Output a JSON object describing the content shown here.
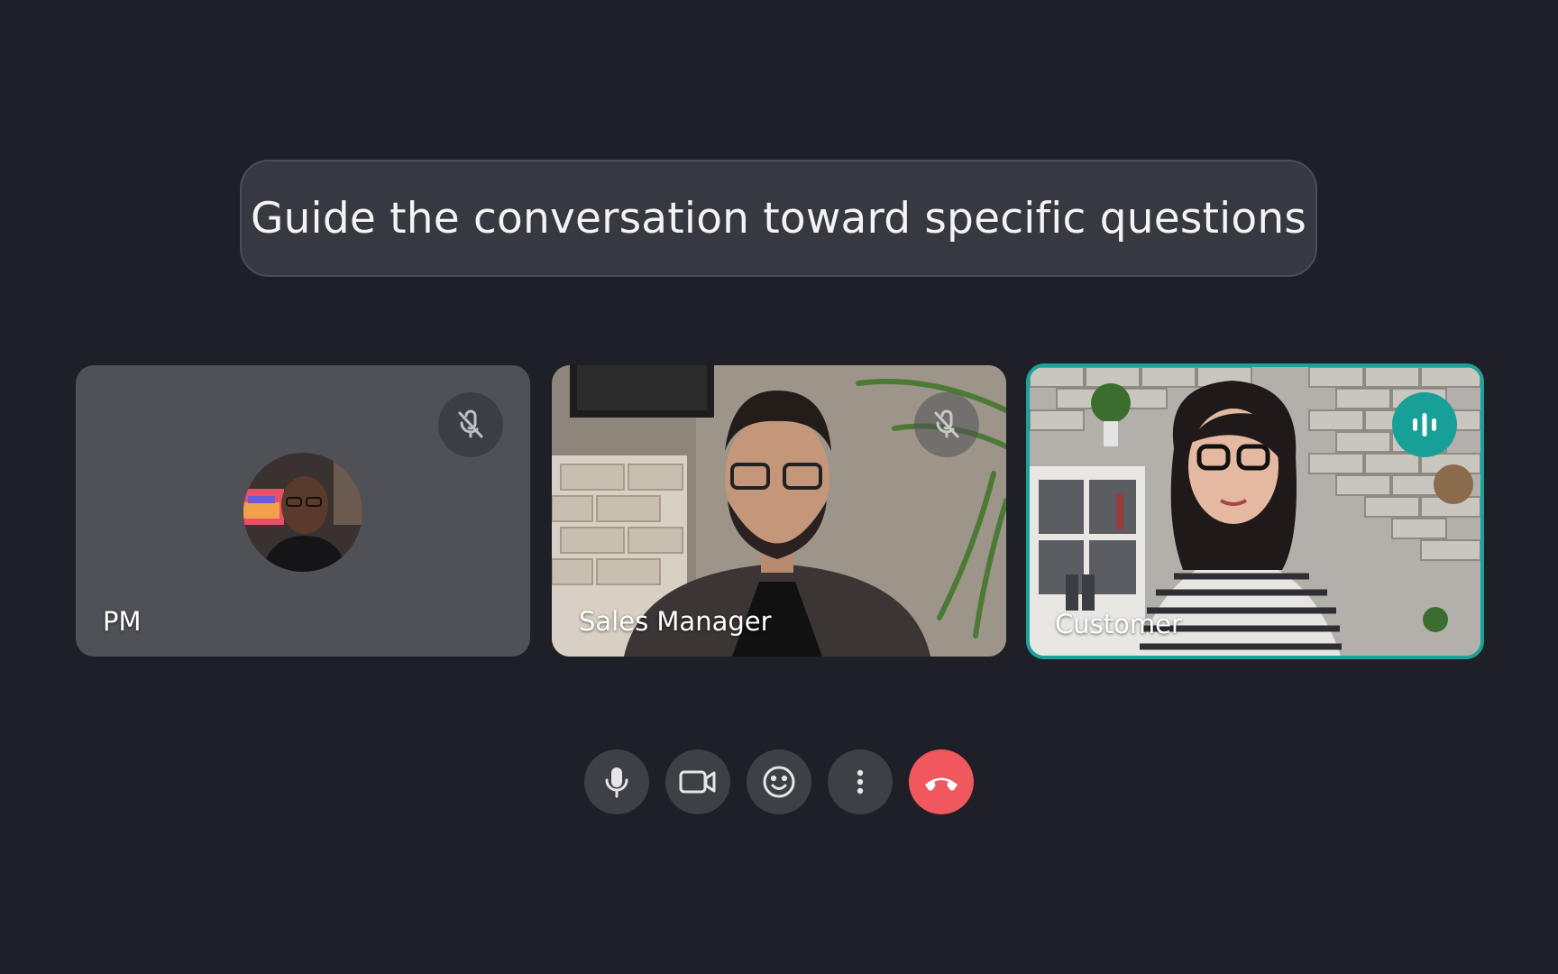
{
  "prompt": {
    "text": "Guide the conversation toward specific questions"
  },
  "participants": [
    {
      "name": "PM",
      "mic_muted": true,
      "video": false,
      "speaking": false
    },
    {
      "name": "Sales Manager",
      "mic_muted": true,
      "video": true,
      "speaking": false
    },
    {
      "name": "Customer",
      "mic_muted": false,
      "video": true,
      "speaking": true
    }
  ],
  "controls": [
    {
      "icon": "microphone-icon"
    },
    {
      "icon": "camera-icon"
    },
    {
      "icon": "emoji-icon"
    },
    {
      "icon": "more-vertical-icon"
    },
    {
      "icon": "end-call-icon"
    }
  ],
  "colors": {
    "background": "#1f1f27",
    "speaking_accent": "#1aa39a",
    "end_call": "#f0585e"
  }
}
